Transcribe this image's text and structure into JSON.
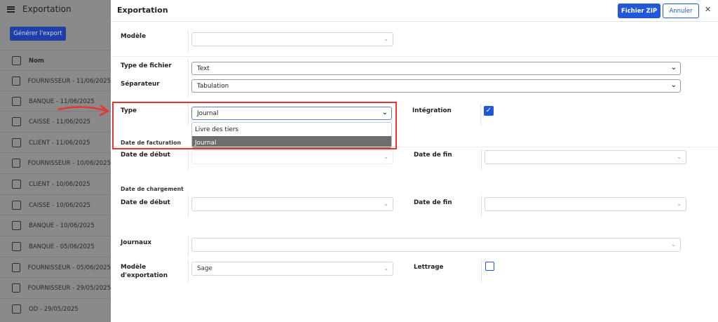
{
  "left_panel": {
    "title": "Exportation",
    "generate_button": "Générer l'export",
    "column_header": "Nom",
    "rows": [
      "FOURNISSEUR - 11/06/2025",
      "BANQUE - 11/06/2025",
      "CAISSE - 11/06/2025",
      "CLIENT - 11/06/2025",
      "FOURNISSEUR - 10/06/2025",
      "CLIENT - 10/06/2025",
      "CAISSE - 10/06/2025",
      "BANQUE - 10/06/2025",
      "BANQUE - 05/06/2025",
      "FOURNISSEUR - 05/06/2025",
      "FOURNISSEUR - 29/05/2025",
      "OD - 29/05/2025"
    ]
  },
  "main": {
    "title": "Exportation",
    "zip_button": "Fichier ZIP",
    "cancel_button": "Annuler",
    "close_icon": "close-icon",
    "modele_label": "Modèle",
    "modele_value": "",
    "type_fichier_label": "Type de fichier",
    "type_fichier_value": "Text",
    "separateur_label": "Séparateur",
    "separateur_value": "Tabulation",
    "type_label": "Type",
    "type_value": "Journal",
    "type_options": [
      "Livre des tiers",
      "Journal"
    ],
    "type_selected": "Journal",
    "integration_label": "Intégration",
    "integration_checked": true,
    "section_facturation": "Date de facturation",
    "fact_debut_label": "Date de début",
    "fact_fin_label": "Date de fin",
    "section_chargement": "Date de chargement",
    "charg_debut_label": "Date de début",
    "charg_fin_label": "Date de fin",
    "journaux_label": "Journaux",
    "modele_export_label_1": "Modèle",
    "modele_export_label_2": "d'exportation",
    "modele_export_value": "Sage",
    "lettrage_label": "Lettrage",
    "lettrage_checked": false
  },
  "colors": {
    "accent": "#2257d9",
    "highlight": "#e53535",
    "overlay": "#8a8a8a",
    "generate_button": "#1f3fa6"
  }
}
